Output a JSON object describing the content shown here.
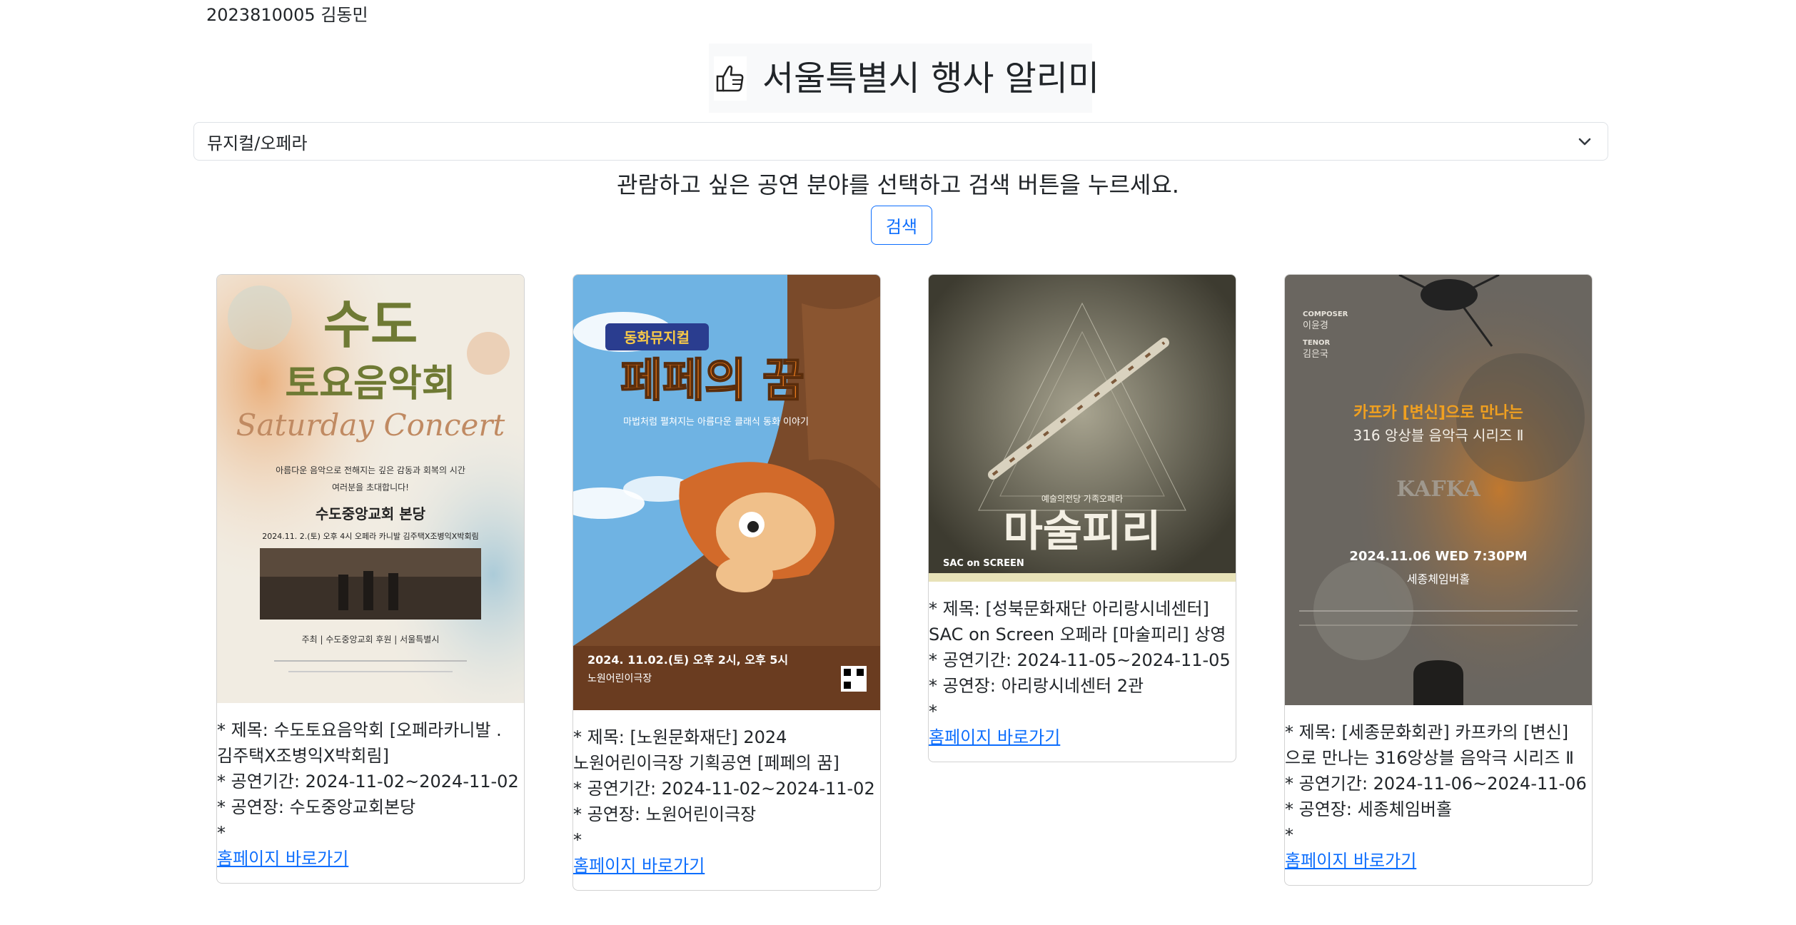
{
  "header": {
    "student": "2023810005 김동민",
    "title": "서울특별시 행사 알리미"
  },
  "filter": {
    "selected": "뮤지컬/오페라",
    "instruction": "관람하고 싶은 공연 분야를 선택하고 검색 버튼을 누르세요.",
    "search_label": "검색"
  },
  "cards": [
    {
      "title": "* 제목: 수도토요음악회 [오페라카니발 . 김주택X조병익X박회림]",
      "period": "* 공연기간: 2024-11-02~2024-11-02",
      "venue": "* 공연장: 수도중앙교회본당",
      "extra": "*",
      "link": "홈페이지 바로가기",
      "poster": {
        "headline1": "수도",
        "headline2": "토요음악회",
        "script": "Saturday Concert",
        "desc1": "아름다운 음악으로 전해지는 깊은 감동과 회복의 시간",
        "desc2": "여러분을 초대합니다!",
        "place": "수도중앙교회 본당",
        "date": "2024.11. 2.(토) 오후 4시 오페라 카니발   김주택X조병익X박회림",
        "host": "주최 | 수도중앙교회   후원 | 서울특별시"
      }
    },
    {
      "title": "* 제목: [노원문화재단] 2024 노원어린이극장 기획공연 [페페의 꿈]",
      "period": "* 공연기간: 2024-11-02~2024-11-02",
      "venue": "* 공연장: 노원어린이극장",
      "extra": "*",
      "link": "홈페이지 바로가기",
      "poster": {
        "tag": "동화뮤지컬",
        "headline": "페페의 꿈",
        "sub": "마법처럼 펼쳐지는 아름다운 클래식 동화 이야기",
        "date": "2024. 11.02.(토) 오후 2시, 오후 5시",
        "place": "노원어린이극장"
      }
    },
    {
      "title": "* 제목: [성북문화재단 아리랑시네센터] SAC on Screen 오페라 [마술피리] 상영",
      "period": "* 공연기간: 2024-11-05~2024-11-05",
      "venue": "* 공연장: 아리랑시네센터 2관",
      "extra": "*",
      "link": "홈페이지 바로가기",
      "poster": {
        "headline": "마술피리",
        "sub": "예술의전당 가족오페라",
        "brand": "SAC on SCREEN"
      }
    },
    {
      "title": "* 제목: [세종문화회관] 카프카의 [변신]으로 만나는 316앙상블 음악극 시리즈 Ⅱ",
      "period": "* 공연기간: 2024-11-06~2024-11-06",
      "venue": "* 공연장: 세종체임버홀",
      "extra": "*",
      "link": "홈페이지 바로가기",
      "poster": {
        "composer_label": "COMPOSER",
        "composer": "이윤경",
        "tenor_label": "TENOR",
        "tenor": "김은국",
        "headline1": "카프카 [변신]으로 만나는",
        "headline2": "316 앙상블 음악극 시리즈 Ⅱ",
        "kafka": "KAFKA",
        "date": "2024.11.06 WED 7:30PM",
        "place": "세종체임버홀"
      }
    }
  ],
  "colors": {
    "accent": "#0d6efd",
    "title_bg": "#f8f9fa",
    "border": "#dee2e6"
  }
}
